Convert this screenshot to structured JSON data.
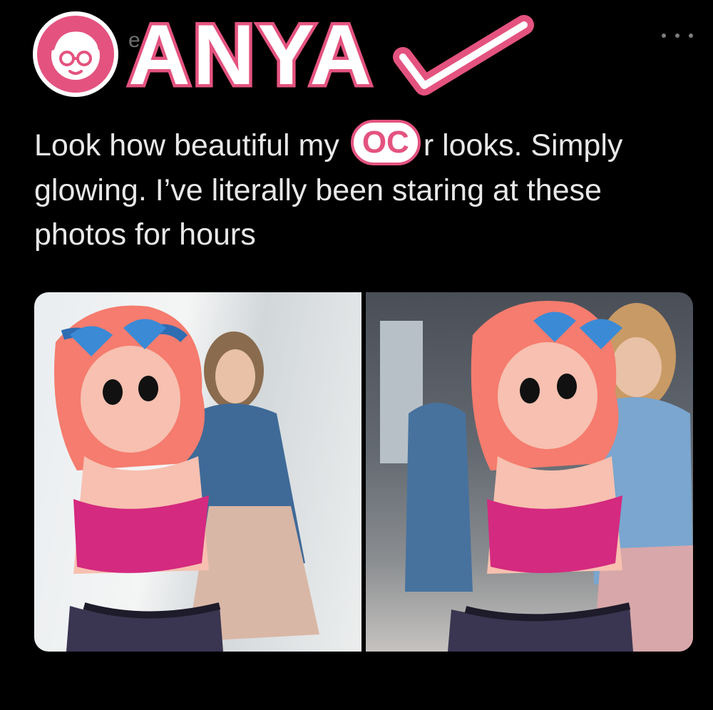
{
  "header": {
    "name_scribble": "ANYA",
    "handle_partial": "e S",
    "avatar_icon": "cartoon-face-icon",
    "more_icon": "ellipsis-icon",
    "check_icon": "checkmark-icon"
  },
  "tweet": {
    "text_before": "Look how beautiful my",
    "oc_overlay": "OC",
    "text_after": "r looks. Simply glowing. I’ve literally been staring at these photos for hours"
  },
  "colors": {
    "accent_pink": "#e4537f",
    "background": "#000000",
    "text": "#e8e8e8"
  }
}
